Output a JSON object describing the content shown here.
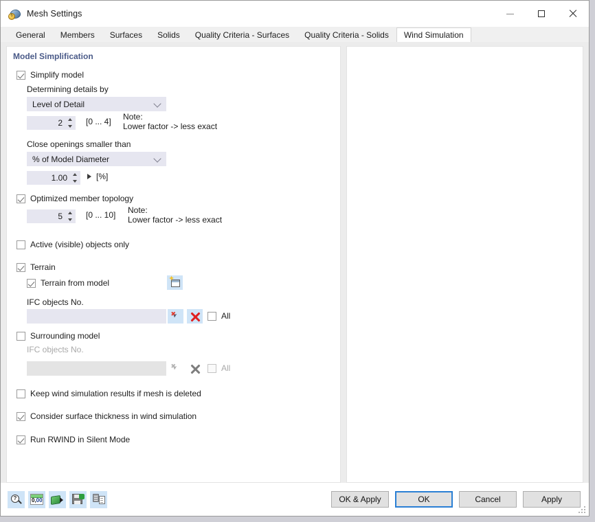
{
  "window": {
    "title": "Mesh Settings",
    "app_icon": "mesh-settings-icon",
    "minimize": "minimize-icon",
    "maximize": "maximize-icon",
    "close": "close-icon"
  },
  "tabs": [
    {
      "label": "General",
      "active": false
    },
    {
      "label": "Members",
      "active": false
    },
    {
      "label": "Surfaces",
      "active": false
    },
    {
      "label": "Solids",
      "active": false
    },
    {
      "label": "Quality Criteria - Surfaces",
      "active": false
    },
    {
      "label": "Quality Criteria - Solids",
      "active": false
    },
    {
      "label": "Wind Simulation",
      "active": true
    }
  ],
  "section": {
    "title": "Model Simplification",
    "title_color": "#4a5a88"
  },
  "form": {
    "simplify_model": {
      "label": "Simplify model",
      "checked": true
    },
    "determining_details_by": {
      "label": "Determining details by",
      "selected": "Level of Detail"
    },
    "level_of_detail": {
      "value": "2",
      "range": "[0 ... 4]",
      "note": "Note:\nLower factor -> less exact"
    },
    "close_openings": {
      "label": "Close openings smaller than",
      "selected": "% of Model Diameter",
      "value": "1.00",
      "unit": "[%]"
    },
    "optimized_member_topology": {
      "label": "Optimized member topology",
      "checked": true,
      "value": "5",
      "range": "[0 ... 10]",
      "note": "Note:\nLower factor -> less exact"
    },
    "active_visible_objects_only": {
      "label": "Active (visible) objects only",
      "checked": false
    },
    "terrain": {
      "label": "Terrain",
      "checked": true,
      "from_model": {
        "label": "Terrain from model",
        "checked": true
      },
      "pick_button_icon": "terrain-from-model-icon",
      "ifc_label": "IFC objects No.",
      "ifc_value": "",
      "select_icon": "select-objects-icon",
      "clear_icon": "clear-selection-icon",
      "all_label": "All",
      "all_checked": false
    },
    "surrounding_model": {
      "label": "Surrounding model",
      "checked": false,
      "ifc_label": "IFC objects No.",
      "ifc_value": "",
      "select_icon": "select-objects-icon",
      "clear_icon": "clear-selection-icon",
      "all_label": "All",
      "all_checked": false
    },
    "keep_results": {
      "label": "Keep wind simulation results if mesh is deleted",
      "checked": false
    },
    "consider_thickness": {
      "label": "Consider surface thickness in wind simulation",
      "checked": true
    },
    "silent_mode": {
      "label": "Run RWIND in Silent Mode",
      "checked": true
    }
  },
  "footer": {
    "tools": [
      {
        "name": "help-icon"
      },
      {
        "name": "units-icon"
      },
      {
        "name": "export-model-icon"
      },
      {
        "name": "save-settings-icon"
      },
      {
        "name": "copy-settings-icon"
      }
    ],
    "buttons": [
      {
        "label": "OK & Apply",
        "default": false
      },
      {
        "label": "OK",
        "default": true
      },
      {
        "label": "Cancel",
        "default": false
      },
      {
        "label": "Apply",
        "default": false
      }
    ]
  }
}
